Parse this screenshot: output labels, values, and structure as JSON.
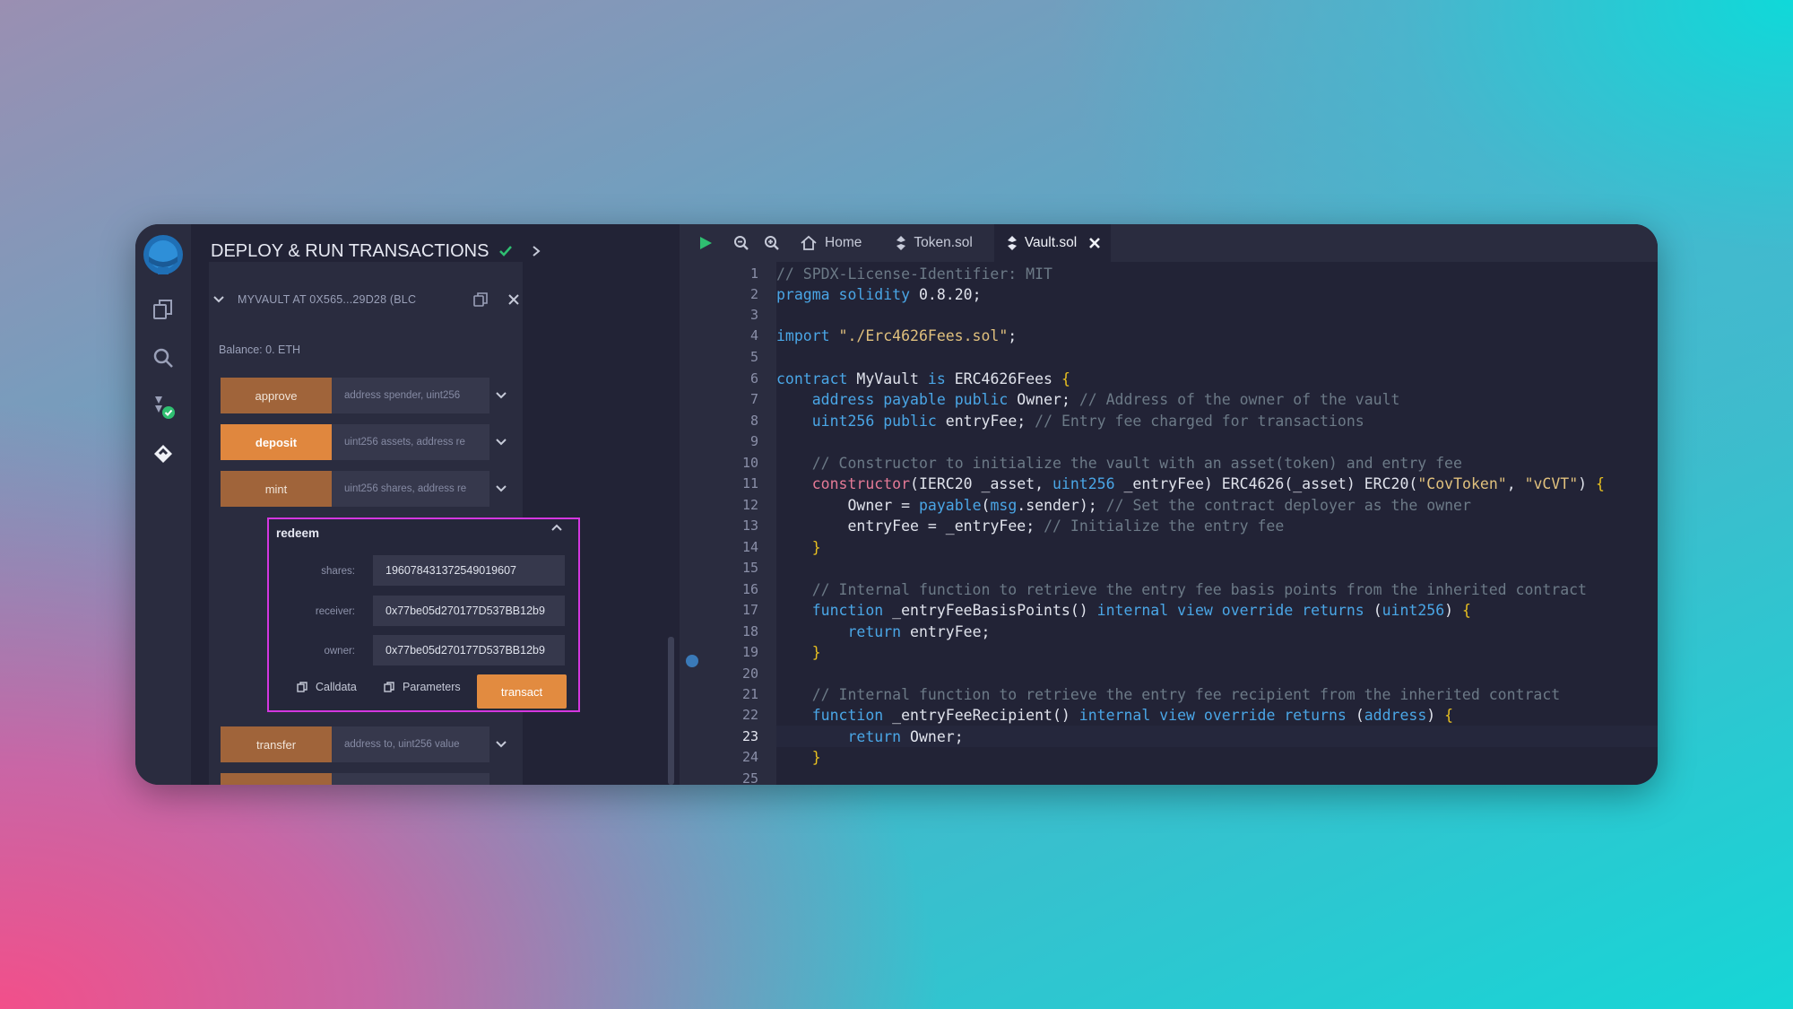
{
  "panel": {
    "title": "DEPLOY & RUN TRANSACTIONS",
    "instance_label": "MYVAULT AT 0X565...29D28 (BLC",
    "balance": "Balance: 0. ETH",
    "functions": [
      {
        "name": "approve",
        "placeholder": "address spender, uint256",
        "active": false
      },
      {
        "name": "deposit",
        "placeholder": "uint256 assets, address re",
        "active": true
      },
      {
        "name": "mint",
        "placeholder": "uint256 shares, address re",
        "active": false
      }
    ],
    "redeem": {
      "title": "redeem",
      "params": [
        {
          "label": "shares:",
          "value": "1960784313725490196​07"
        },
        {
          "label": "receiver:",
          "value": "0x77be05d270177D537BB12b9"
        },
        {
          "label": "owner:",
          "value": "0x77be05d270177D537BB12b9"
        }
      ],
      "calldata_label": "Calldata",
      "parameters_label": "Parameters",
      "transact_label": "transact"
    },
    "after_functions": [
      {
        "name": "transfer",
        "placeholder": "address to, uint256 value"
      }
    ]
  },
  "editor": {
    "tabs": [
      {
        "label": "Home",
        "icon": "home-icon"
      },
      {
        "label": "Token.sol",
        "icon": "solidity-icon"
      },
      {
        "label": "Vault.sol",
        "icon": "solidity-icon",
        "active": true
      }
    ],
    "current_line": 23,
    "lines": [
      "// SPDX-License-Identifier: MIT",
      "pragma solidity 0.8.20;",
      "",
      "import \"./Erc4626Fees.sol\";",
      "",
      "contract MyVault is ERC4626Fees {",
      "    address payable public Owner; // Address of the owner of the vault",
      "    uint256 public entryFee; // Entry fee charged for transactions",
      "",
      "    // Constructor to initialize the vault with an asset(token) and entry fee",
      "    constructor(IERC20 _asset, uint256 _entryFee) ERC4626(_asset) ERC20(\"CovToken\", \"vCVT\") {",
      "        Owner = payable(msg.sender); // Set the contract deployer as the owner",
      "        entryFee = _entryFee; // Initialize the entry fee",
      "    }",
      "",
      "    // Internal function to retrieve the entry fee basis points from the inherited contract",
      "    function _entryFeeBasisPoints() internal view override returns (uint256) {",
      "        return entryFee;",
      "    }",
      "",
      "    // Internal function to retrieve the entry fee recipient from the inherited contract",
      "    function _entryFeeRecipient() internal view override returns (address) {",
      "        return Owner;",
      "    }",
      ""
    ],
    "line_numbers": [
      "1",
      "2",
      "3",
      "4",
      "5",
      "6",
      "7",
      "8",
      "9",
      "10",
      "11",
      "12",
      "13",
      "14",
      "15",
      "16",
      "17",
      "18",
      "19",
      "20",
      "21",
      "22",
      "23",
      "24",
      "25"
    ]
  },
  "colors": {
    "accent": "#e28b40",
    "highlight_border": "#d437e0",
    "window_bg": "#222336"
  }
}
